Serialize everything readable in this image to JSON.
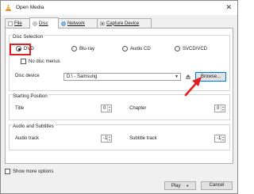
{
  "window": {
    "title": "Open Media"
  },
  "tabs": [
    {
      "label": "File"
    },
    {
      "label": "Disc"
    },
    {
      "label": "Network"
    },
    {
      "label": "Capture Device"
    }
  ],
  "disc_selection": {
    "title": "Disc Selection",
    "options": [
      "DVD",
      "Blu-ray",
      "Audio CD",
      "SVCD/VCD"
    ],
    "selected": "DVD",
    "no_menus_label": "No disc menus",
    "device_label": "Disc device",
    "device_value": "D:\\ - Samsung",
    "browse_label": "Browse..."
  },
  "starting_position": {
    "title": "Starting Position",
    "title_label": "Title",
    "title_value": "0",
    "chapter_label": "Chapter",
    "chapter_value": "0"
  },
  "audio_subtitles": {
    "title": "Audio and Subtitles",
    "audio_label": "Audio track",
    "audio_value": "-1",
    "subtitle_label": "Subtitle track",
    "subtitle_value": "-1"
  },
  "footer": {
    "show_more_label": "Show more options",
    "play_label": "Play",
    "cancel_label": "Cancel"
  },
  "colors": {
    "annotation_red": "#e02020",
    "focus_blue": "#0078d7",
    "vlc_orange": "#f08a00"
  }
}
